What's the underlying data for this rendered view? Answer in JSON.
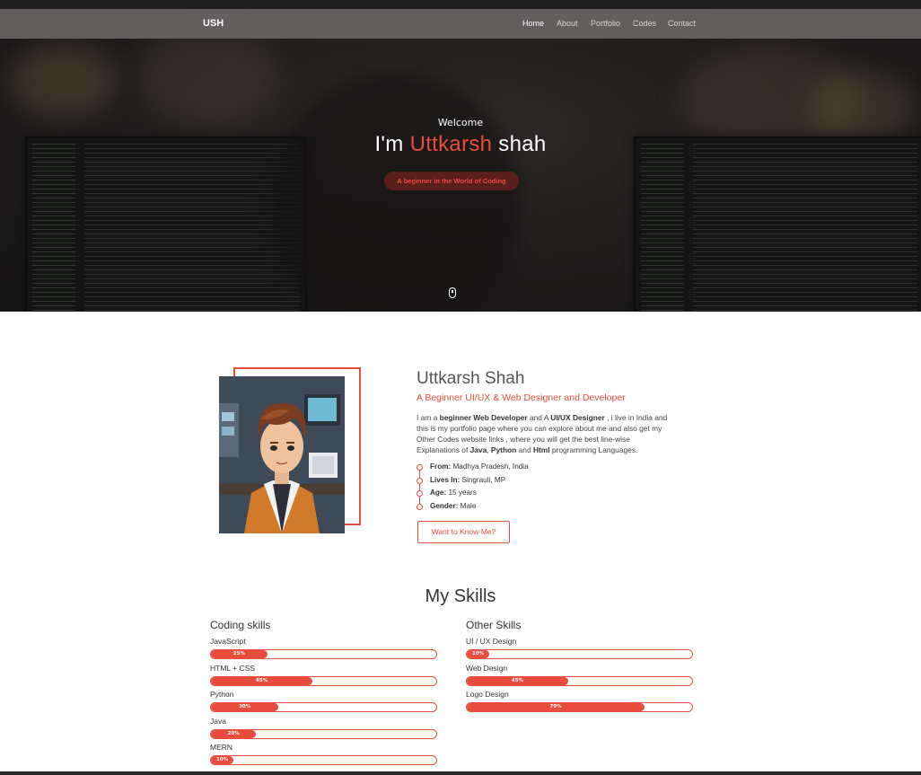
{
  "nav": {
    "brand": "USH",
    "links": [
      "Home",
      "About",
      "Portfolio",
      "Codes",
      "Contact"
    ],
    "active": "Home"
  },
  "hero": {
    "welcome": "Welcome",
    "headline_pre": "I'm ",
    "headline_accent": "Uttkarsh",
    "headline_post": " shah",
    "tagline": "A beginner in the World of Coding"
  },
  "about": {
    "name": "Uttkarsh Shah",
    "role": "A Beginner UI/UX & Web Designer and Developer",
    "bio": {
      "p1": "I am a ",
      "b1": "beginner Web Developer",
      "p2": " and A ",
      "b2": "UI/UX Designer",
      "p3": " , i live in India and this is my portfolio page where you can explore about me and also get my Other Codes website links , where you will get the best line-wise Explanations of ",
      "b3": "Java",
      "p4": ", ",
      "b4": "Python",
      "p5": " and ",
      "b5": "Html",
      "p6": " programming Languages."
    },
    "facts": [
      {
        "label": "From:",
        "value": " Madhya Pradesh, India"
      },
      {
        "label": "Lives In:",
        "value": " Singrauli, MP"
      },
      {
        "label": "Age:",
        "value": " 15 years"
      },
      {
        "label": "Gender:",
        "value": " Male"
      }
    ],
    "button": "Want to Know Me?"
  },
  "skills": {
    "title": "My Skills",
    "coding_title": "Coding skills",
    "other_title": "Other Skills",
    "coding": [
      {
        "name": "JavaScript",
        "percent": 25,
        "label": "25%"
      },
      {
        "name": "HTML + CSS",
        "percent": 45,
        "label": "45%"
      },
      {
        "name": "Python",
        "percent": 30,
        "label": "30%"
      },
      {
        "name": "Java",
        "percent": 20,
        "label": "20%"
      },
      {
        "name": "MERN",
        "percent": 10,
        "label": "10%"
      }
    ],
    "other": [
      {
        "name": "UI / UX Design",
        "percent": 10,
        "label": "10%"
      },
      {
        "name": "Web Design",
        "percent": 45,
        "label": "45%"
      },
      {
        "name": "Logo Design",
        "percent": 79,
        "label": "79%"
      }
    ]
  },
  "colors": {
    "accent": "#e74c3c",
    "navbar": "#6e6a6a"
  }
}
